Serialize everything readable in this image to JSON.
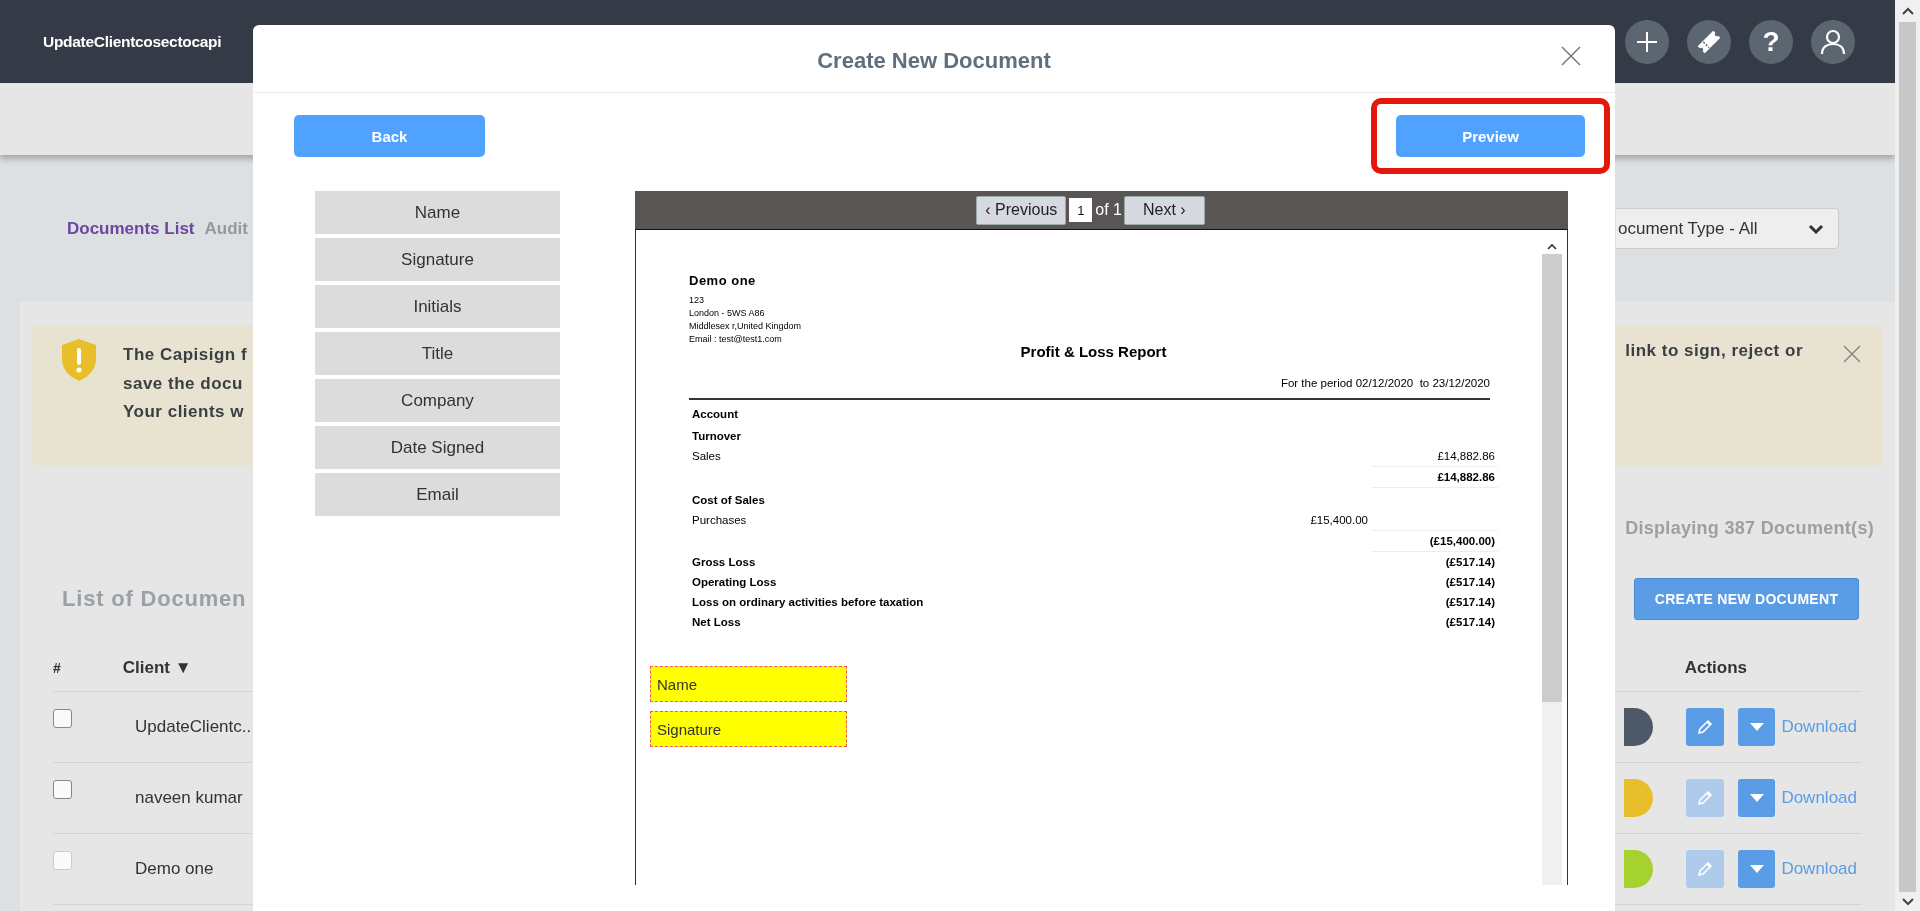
{
  "app_bar": {
    "title": "UpdateClientcosectocapi",
    "help": "?"
  },
  "page": {
    "tabs": [
      {
        "label": "Documents List",
        "selected": true
      },
      {
        "label": "Audit",
        "selected": false
      }
    ],
    "document_type_filter": {
      "value": "ocument Type - All"
    },
    "alert": {
      "left_lines": [
        "The Capisign f",
        "save the docu",
        "Your clients w"
      ],
      "right_line": "link to sign, reject or"
    },
    "list_title": "List of Documen",
    "document_count": "Displaying 387 Document(s)",
    "create_button": "CREATE NEW DOCUMENT",
    "table": {
      "columns": [
        "#",
        "Client ▼",
        "Actions"
      ],
      "rows": [
        {
          "checked": false,
          "disabled": false,
          "client": "UpdateClientc..",
          "color": "#4d5966",
          "edit_disabled": false,
          "download": "Download"
        },
        {
          "checked": false,
          "disabled": false,
          "client": "naveen kumar",
          "color": "#e8bf2a",
          "edit_disabled": true,
          "download": "Download"
        },
        {
          "checked": false,
          "disabled": true,
          "client": "Demo one",
          "color": "#a5d22e",
          "edit_disabled": true,
          "download": "Download"
        }
      ]
    }
  },
  "modal": {
    "title": "Create New Document",
    "back_button": "Back",
    "preview_button": {
      "label": "Preview",
      "highlighted": true
    },
    "fields": [
      "Name",
      "Signature",
      "Initials",
      "Title",
      "Company",
      "Date Signed",
      "Email"
    ],
    "viewer": {
      "previous": "‹ Previous",
      "page": "1",
      "page_of": "of 1",
      "next": "Next ›",
      "document": {
        "company": "Demo one",
        "address": [
          "123",
          "London - 5WS A86",
          "Middlesex r,United Kingdom",
          "Email : test@test1.com"
        ],
        "title": "Profit & Loss Report",
        "period": "For the period 02/12/2020  to 23/12/2020",
        "rows": [
          {
            "kind": "heading",
            "label": "Account"
          },
          {
            "kind": "heading",
            "label": "Turnover"
          },
          {
            "kind": "line",
            "label": "Sales",
            "total": "£14,882.86"
          },
          {
            "kind": "subtotal",
            "total": "£14,882.86"
          },
          {
            "kind": "heading",
            "label": "Cost of Sales"
          },
          {
            "kind": "line",
            "label": "Purchases",
            "amount": "£15,400.00"
          },
          {
            "kind": "subtotal",
            "total": "(£15,400.00)"
          },
          {
            "kind": "total",
            "label": "Gross Loss",
            "total": "(£517.14)"
          },
          {
            "kind": "total",
            "label": "Operating Loss",
            "total": "(£517.14)"
          },
          {
            "kind": "total",
            "label": "Loss on ordinary activities before taxation",
            "total": "(£517.14)"
          },
          {
            "kind": "total",
            "label": "Net Loss",
            "total": "(£517.14)"
          }
        ]
      },
      "placed_fields": [
        "Name",
        "Signature"
      ]
    }
  }
}
